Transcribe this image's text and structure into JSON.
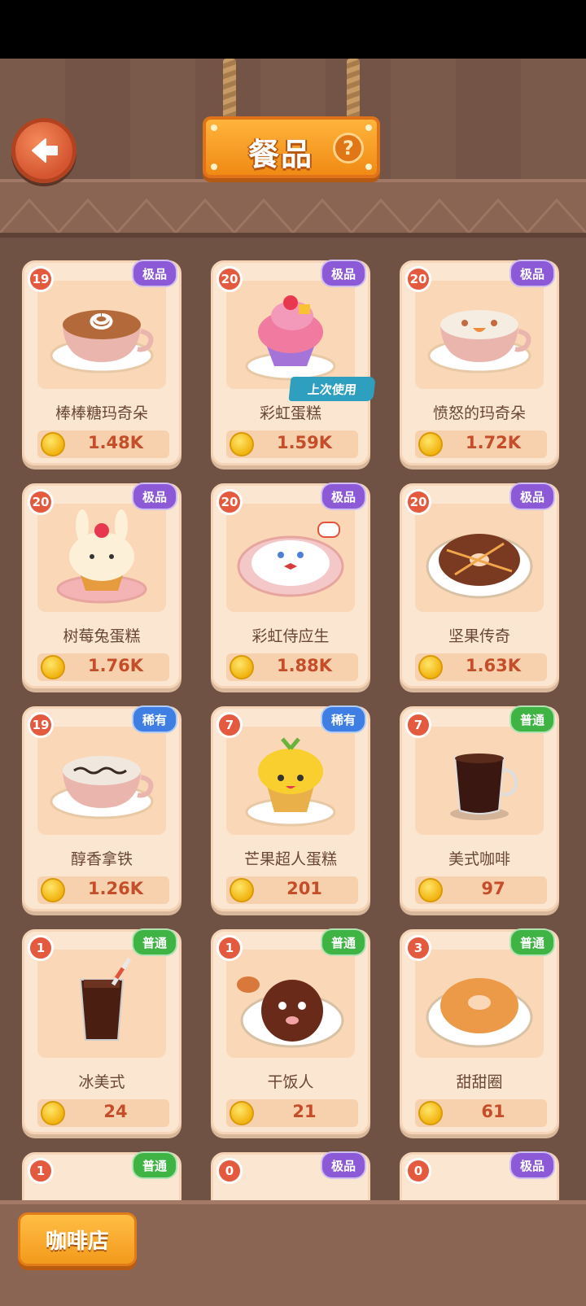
{
  "header": {
    "title": "餐品",
    "help_label": "?"
  },
  "items": [
    {
      "level": "19",
      "rarity": "极品",
      "rarity_type": "epic",
      "name": "棒棒糖玛奇朵",
      "price": "1.48K"
    },
    {
      "level": "20",
      "rarity": "极品",
      "rarity_type": "epic",
      "name": "彩虹蛋糕",
      "price": "1.59K",
      "badge": "上次使用"
    },
    {
      "level": "20",
      "rarity": "极品",
      "rarity_type": "epic",
      "name": "愤怒的玛奇朵",
      "price": "1.72K"
    },
    {
      "level": "20",
      "rarity": "极品",
      "rarity_type": "epic",
      "name": "树莓兔蛋糕",
      "price": "1.76K"
    },
    {
      "level": "20",
      "rarity": "极品",
      "rarity_type": "epic",
      "name": "彩虹侍应生",
      "price": "1.88K"
    },
    {
      "level": "20",
      "rarity": "极品",
      "rarity_type": "epic",
      "name": "坚果传奇",
      "price": "1.63K"
    },
    {
      "level": "19",
      "rarity": "稀有",
      "rarity_type": "rare",
      "name": "醇香拿铁",
      "price": "1.26K"
    },
    {
      "level": "7",
      "rarity": "稀有",
      "rarity_type": "rare",
      "name": "芒果超人蛋糕",
      "price": "201"
    },
    {
      "level": "7",
      "rarity": "普通",
      "rarity_type": "common",
      "name": "美式咖啡",
      "price": "97"
    },
    {
      "level": "1",
      "rarity": "普通",
      "rarity_type": "common",
      "name": "冰美式",
      "price": "24"
    },
    {
      "level": "1",
      "rarity": "普通",
      "rarity_type": "common",
      "name": "干饭人",
      "price": "21"
    },
    {
      "level": "3",
      "rarity": "普通",
      "rarity_type": "common",
      "name": "甜甜圈",
      "price": "61"
    },
    {
      "level": "1",
      "rarity": "普通",
      "rarity_type": "common"
    },
    {
      "level": "0",
      "rarity": "极品",
      "rarity_type": "epic"
    },
    {
      "level": "0",
      "rarity": "极品",
      "rarity_type": "epic"
    }
  ],
  "colors": {
    "epic": "#8c5ad6",
    "rare": "#3f7fe3",
    "common": "#3fb344",
    "price_text": "#c44d2a"
  },
  "bottom": {
    "shop_label": "咖啡店"
  }
}
